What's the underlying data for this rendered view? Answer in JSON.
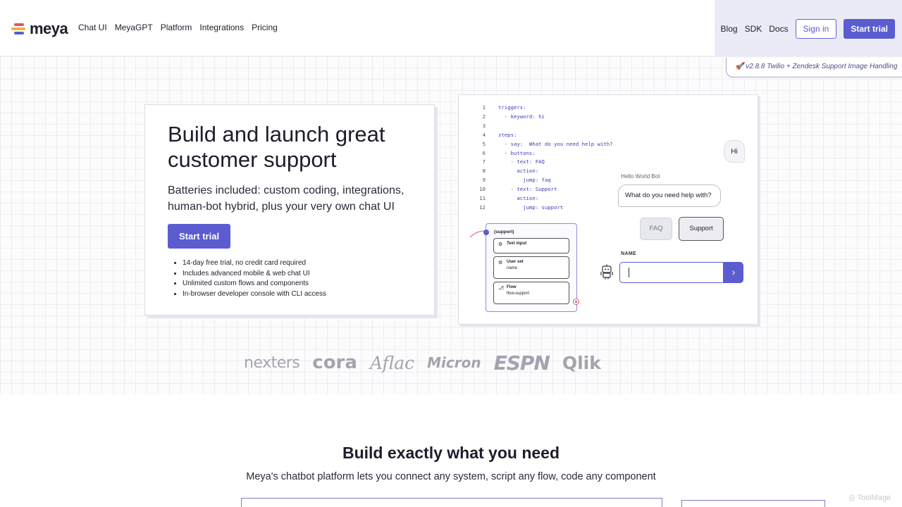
{
  "brand": {
    "name": "meya",
    "colors": [
      "#e0546a",
      "#f0b43c",
      "#5a5cd0"
    ]
  },
  "nav": {
    "links": [
      "Chat UI",
      "MeyaGPT",
      "Platform",
      "Integrations",
      "Pricing"
    ],
    "right_links": [
      "Blog",
      "SDK",
      "Docs"
    ],
    "sign_in": "Sign in",
    "start_trial": "Start trial"
  },
  "version_badge": "🚀 v2.8.8 Twilio + Zendesk Support Image Handling",
  "hero": {
    "title": "Build and launch great customer support",
    "subtitle": "Batteries included: custom coding, integrations, human-bot hybrid, plus your very own chat UI",
    "cta": "Start trial",
    "bullets": [
      "14-day free trial, no credit card required",
      "Includes advanced mobile & web chat UI",
      "Unlimited custom flows and components",
      "In-browser developer console with CLI access"
    ]
  },
  "demo": {
    "code_lines": [
      {
        "n": "1",
        "text": "triggers:"
      },
      {
        "n": "2",
        "text": "  - keyword: hi"
      },
      {
        "n": "3",
        "text": ""
      },
      {
        "n": "4",
        "text": "steps:"
      },
      {
        "n": "5",
        "text": "  - say:  What do you need help with?"
      },
      {
        "n": "6",
        "text": "  - buttons:"
      },
      {
        "n": "7",
        "text": "    - text: FAQ"
      },
      {
        "n": "8",
        "text": "      action:"
      },
      {
        "n": "9",
        "text": "        jump: faq"
      },
      {
        "n": "10",
        "text": "    - text: Support"
      },
      {
        "n": "11",
        "text": "      action:"
      },
      {
        "n": "12",
        "text": "        jump: support"
      }
    ],
    "user_message": "Hi",
    "bot_name": "Hello World Bot",
    "bot_message": "What do you need help with?",
    "button_faq": "FAQ",
    "button_support": "Support",
    "input_label": "NAME",
    "flow": {
      "title": "(support)",
      "items": [
        {
          "icon": "text-input-icon",
          "label": "Text input",
          "sub": ""
        },
        {
          "icon": "user-set-icon",
          "label": "User set",
          "sub": "name"
        },
        {
          "icon": "flow-icon",
          "label": "Flow",
          "sub": "flow.support"
        }
      ]
    }
  },
  "logos": [
    "nexters",
    "cora",
    "Aflac",
    "Micron",
    "ESPN",
    "Qlik"
  ],
  "section2": {
    "title": "Build exactly what you need",
    "subtitle": "Meya's chatbot platform lets you connect any system, script any flow, code any component"
  },
  "watermark": "ToolMage"
}
